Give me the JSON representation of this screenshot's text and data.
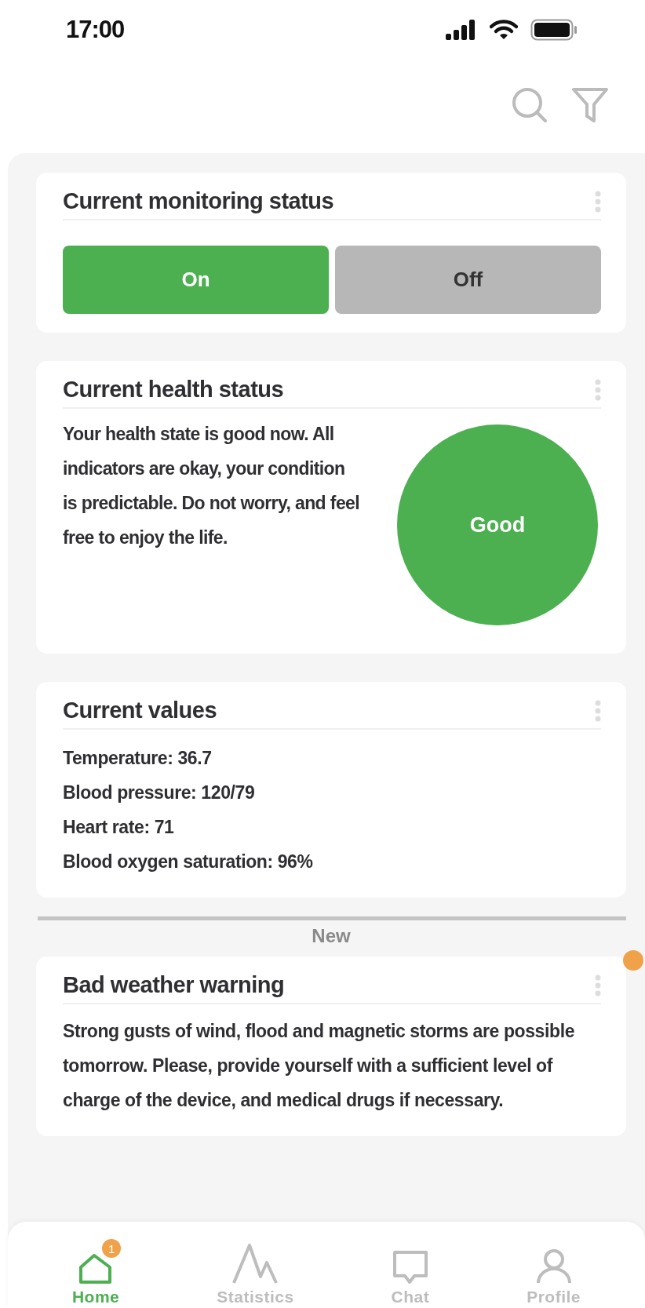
{
  "status_bar": {
    "time": "17:00"
  },
  "monitoring": {
    "title": "Current monitoring status",
    "options": [
      {
        "label": "On",
        "selected": true
      },
      {
        "label": "Off",
        "selected": false
      }
    ]
  },
  "health": {
    "title": "Current health status",
    "text": "Your health state is good now. All indicators are okay, your condition is predictable. Do not worry, and feel free to enjoy the life.",
    "status": "Good"
  },
  "values": {
    "title": "Current values",
    "lines": [
      "Temperature: 36.7",
      "Blood pressure: 120/79",
      "Heart rate: 71",
      "Blood oxygen saturation: 96%"
    ]
  },
  "separator_label": "New",
  "warning": {
    "title": "Bad weather warning",
    "text": "Strong gusts of wind, flood and magnetic storms are possible tomorrow. Please, provide yourself with a sufficient level of charge of the device, and medical drugs if necessary.",
    "unread": true
  },
  "nav": [
    {
      "label": "Home",
      "selected": true,
      "badge": "1"
    },
    {
      "label": "Statistics",
      "selected": false
    },
    {
      "label": "Chat",
      "selected": false
    },
    {
      "label": "Profile",
      "selected": false
    }
  ]
}
